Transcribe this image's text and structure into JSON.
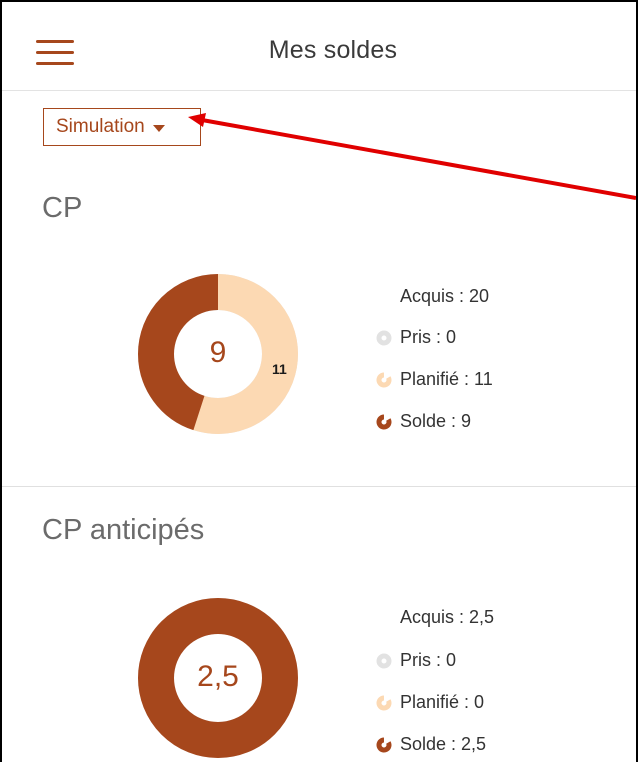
{
  "header": {
    "title": "Mes soldes",
    "menu_icon": "hamburger-menu-icon"
  },
  "simulation": {
    "label": "Simulation",
    "caret_icon": "caret-down-icon"
  },
  "colors": {
    "accent": "#a6471c",
    "planned": "#fcd9b3",
    "taken": "#e2e2e2",
    "annotation_arrow": "#e00000"
  },
  "sections": [
    {
      "title": "CP",
      "donut": {
        "center_label": "9",
        "side_label": "11",
        "total": 20,
        "taken": 0,
        "planned": 11,
        "balance": 9
      },
      "legend": {
        "acquired": "Acquis : 20",
        "taken": "Pris : 0",
        "planned": "Planifié : 11",
        "balance": "Solde : 9"
      }
    },
    {
      "title": "CP anticipés",
      "donut": {
        "center_label": "2,5",
        "total": 2.5,
        "taken": 0,
        "planned": 0,
        "balance": 2.5
      },
      "legend": {
        "acquired": "Acquis : 2,5",
        "taken": "Pris : 0",
        "planned": "Planifié : 0",
        "balance": "Solde : 2,5"
      }
    }
  ]
}
